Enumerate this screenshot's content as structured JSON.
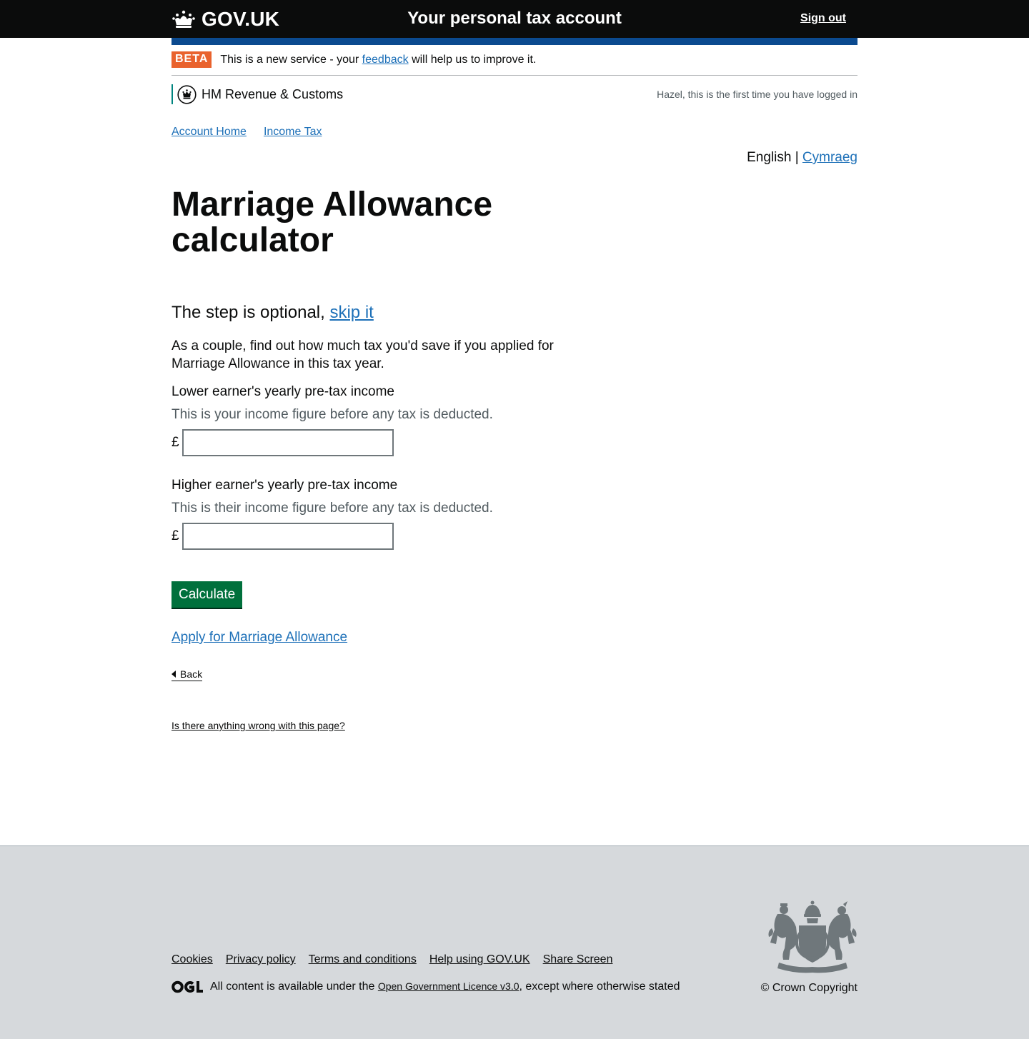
{
  "header": {
    "brand": "GOV.UK",
    "service_name": "Your personal tax account",
    "sign_out": "Sign out"
  },
  "beta": {
    "tag": "BETA",
    "text_before": "This is a new service - your",
    "link": "feedback",
    "text_after": "will help us to improve it."
  },
  "hmrc": {
    "name": "HM Revenue & Customs",
    "last_login": "Hazel, this is the first time you have logged in"
  },
  "breadcrumbs": [
    "Account Home",
    "Income Tax"
  ],
  "language": {
    "current": "English",
    "separator": "|",
    "other": "Cymraeg"
  },
  "main": {
    "title": "Marriage Allowance calculator",
    "optional_text": "The step is optional,",
    "skip_link": "skip it",
    "intro": "As a couple, find out how much tax you'd save if you applied for Marriage Allowance in this tax year.",
    "lower": {
      "label": "Lower earner's yearly pre-tax income",
      "hint": "This is your income figure before any tax is deducted.",
      "currency": "£",
      "value": ""
    },
    "higher": {
      "label": "Higher earner's yearly pre-tax income",
      "hint": "This is their income figure before any tax is deducted.",
      "currency": "£",
      "value": ""
    },
    "calculate_button": "Calculate",
    "apply_link": "Apply for Marriage Allowance",
    "back_link": "Back",
    "report_link": "Is there anything wrong with this page?"
  },
  "footer": {
    "links": [
      "Cookies",
      "Privacy policy",
      "Terms and conditions",
      "Help using GOV.UK",
      "Share Screen"
    ],
    "licence_before": "All content is available under the",
    "licence_link": "Open Government Licence v3.0",
    "licence_after": ", except where otherwise stated",
    "copyright": "© Crown Copyright"
  },
  "colors": {
    "header_bg": "#0b0c0c",
    "accent_blue": "#1d70b8",
    "beta_tag": "#e9622d",
    "button_green": "#00703c",
    "footer_bg": "#d6d9dc",
    "hmrc_border": "#00847f"
  },
  "icons": {
    "brand": "crown-icon",
    "hmrc": "crest-icon",
    "back": "triangle-left-icon",
    "licence": "ogl-logo",
    "footer_crest": "royal-coat-of-arms"
  }
}
